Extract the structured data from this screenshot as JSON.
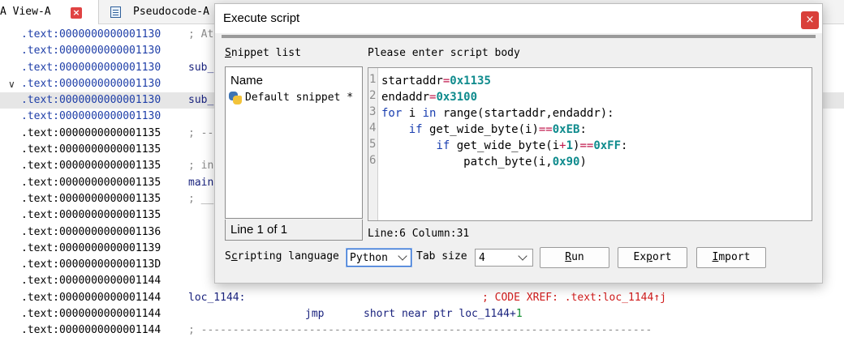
{
  "tabs": [
    {
      "label": "A View-A",
      "close": "×"
    },
    {
      "label": "Pseudocode-A"
    }
  ],
  "listing": [
    {
      "addr": ".text:0000000000001130",
      "rest": "; At",
      "color": "blue"
    },
    {
      "addr": ".text:0000000000001130",
      "rest": "",
      "color": "blue"
    },
    {
      "addr": ".text:0000000000001130",
      "rest": "sub_",
      "ident": true,
      "color": "blue"
    },
    {
      "addr": ".text:0000000000001130",
      "rest": "",
      "color": "blue",
      "caret": "∨"
    },
    {
      "addr": ".text:0000000000001130",
      "rest": "sub_",
      "ident": true,
      "color": "blue",
      "highlight": true
    },
    {
      "addr": ".text:0000000000001130",
      "rest": "",
      "color": "blue"
    },
    {
      "addr": ".text:0000000000001135",
      "rest": "; --",
      "color": "black"
    },
    {
      "addr": ".text:0000000000001135",
      "rest": "",
      "color": "black"
    },
    {
      "addr": ".text:0000000000001135",
      "rest": "; in",
      "color": "black"
    },
    {
      "addr": ".text:0000000000001135",
      "rest": "main",
      "ident": true,
      "color": "black"
    },
    {
      "addr": ".text:0000000000001135",
      "rest": "; __",
      "color": "black"
    },
    {
      "addr": ".text:0000000000001135",
      "rest": "",
      "color": "black"
    },
    {
      "addr": ".text:0000000000001136",
      "rest": "",
      "color": "black"
    },
    {
      "addr": ".text:0000000000001139",
      "rest": "",
      "color": "black"
    },
    {
      "addr": ".text:000000000000113D",
      "rest": "",
      "color": "black"
    },
    {
      "addr": ".text:0000000000001144",
      "rest": "",
      "color": "black"
    },
    {
      "addr": ".text:0000000000001144",
      "rest": "loc_1144:",
      "ident": true,
      "color": "black",
      "xref": "; CODE XREF: .text:loc_1144↑j"
    },
    {
      "addr": ".text:0000000000001144",
      "rest": "",
      "color": "black",
      "mnemonic": "jmp",
      "operand": "short near ptr loc_1144+",
      "operand_num": "1"
    },
    {
      "addr": ".text:0000000000001144",
      "rest": "; -----------------------------------------------------------------------",
      "color": "black"
    }
  ],
  "dialog": {
    "title": "Execute script",
    "close": "×",
    "snippet_list_label": "Snippet list",
    "snippet_column": "Name",
    "snippets": [
      "Default snippet *"
    ],
    "snippet_footer": "Line 1 of 1",
    "body_label": "Please enter script body",
    "line_numbers": [
      "1",
      "2",
      "3",
      "4",
      "5",
      "6"
    ],
    "code_lines": [
      [
        {
          "t": "startaddr"
        },
        {
          "t": "=",
          "c": "op"
        },
        {
          "t": "0x1135",
          "c": "num"
        }
      ],
      [
        {
          "t": "endaddr"
        },
        {
          "t": "=",
          "c": "op"
        },
        {
          "t": "0x3100",
          "c": "num"
        }
      ],
      [
        {
          "t": "for",
          "c": "kw"
        },
        {
          "t": " i "
        },
        {
          "t": "in",
          "c": "kw"
        },
        {
          "t": " range(startaddr,endaddr):"
        }
      ],
      [
        {
          "t": "    "
        },
        {
          "t": "if",
          "c": "kw"
        },
        {
          "t": " get_wide_byte(i)"
        },
        {
          "t": "==",
          "c": "op"
        },
        {
          "t": "0xEB",
          "c": "num"
        },
        {
          "t": ":"
        }
      ],
      [
        {
          "t": "        "
        },
        {
          "t": "if",
          "c": "kw"
        },
        {
          "t": " get_wide_byte(i"
        },
        {
          "t": "+",
          "c": "op"
        },
        {
          "t": "1",
          "c": "num"
        },
        {
          "t": ")"
        },
        {
          "t": "==",
          "c": "op"
        },
        {
          "t": "0xFF",
          "c": "num"
        },
        {
          "t": ":"
        }
      ],
      [
        {
          "t": "            patch_byte(i,"
        },
        {
          "t": "0x90",
          "c": "num"
        },
        {
          "t": ")"
        }
      ]
    ],
    "status": "Line:6  Column:31",
    "scripting_language_label": "Scripting language",
    "scripting_language_value": "Python",
    "tab_size_label": "Tab size",
    "tab_size_value": "4",
    "buttons": {
      "run": {
        "mnemonic": "R",
        "rest": "un"
      },
      "export": {
        "pre": "Ex",
        "mnemonic": "p",
        "rest": "ort"
      },
      "import": {
        "mnemonic": "I",
        "rest": "mport"
      }
    }
  }
}
